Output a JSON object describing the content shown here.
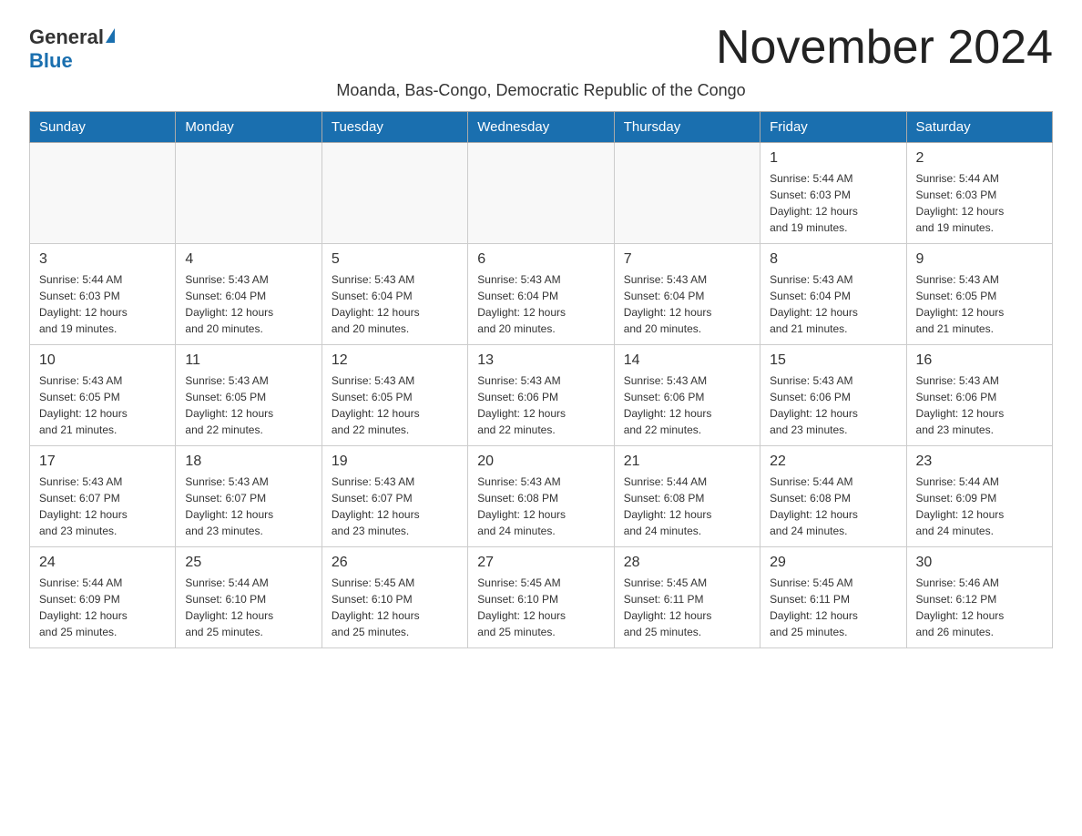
{
  "header": {
    "logo_general": "General",
    "logo_blue": "Blue",
    "month_title": "November 2024",
    "subtitle": "Moanda, Bas-Congo, Democratic Republic of the Congo"
  },
  "weekdays": [
    "Sunday",
    "Monday",
    "Tuesday",
    "Wednesday",
    "Thursday",
    "Friday",
    "Saturday"
  ],
  "weeks": [
    [
      {
        "day": "",
        "info": ""
      },
      {
        "day": "",
        "info": ""
      },
      {
        "day": "",
        "info": ""
      },
      {
        "day": "",
        "info": ""
      },
      {
        "day": "",
        "info": ""
      },
      {
        "day": "1",
        "info": "Sunrise: 5:44 AM\nSunset: 6:03 PM\nDaylight: 12 hours\nand 19 minutes."
      },
      {
        "day": "2",
        "info": "Sunrise: 5:44 AM\nSunset: 6:03 PM\nDaylight: 12 hours\nand 19 minutes."
      }
    ],
    [
      {
        "day": "3",
        "info": "Sunrise: 5:44 AM\nSunset: 6:03 PM\nDaylight: 12 hours\nand 19 minutes."
      },
      {
        "day": "4",
        "info": "Sunrise: 5:43 AM\nSunset: 6:04 PM\nDaylight: 12 hours\nand 20 minutes."
      },
      {
        "day": "5",
        "info": "Sunrise: 5:43 AM\nSunset: 6:04 PM\nDaylight: 12 hours\nand 20 minutes."
      },
      {
        "day": "6",
        "info": "Sunrise: 5:43 AM\nSunset: 6:04 PM\nDaylight: 12 hours\nand 20 minutes."
      },
      {
        "day": "7",
        "info": "Sunrise: 5:43 AM\nSunset: 6:04 PM\nDaylight: 12 hours\nand 20 minutes."
      },
      {
        "day": "8",
        "info": "Sunrise: 5:43 AM\nSunset: 6:04 PM\nDaylight: 12 hours\nand 21 minutes."
      },
      {
        "day": "9",
        "info": "Sunrise: 5:43 AM\nSunset: 6:05 PM\nDaylight: 12 hours\nand 21 minutes."
      }
    ],
    [
      {
        "day": "10",
        "info": "Sunrise: 5:43 AM\nSunset: 6:05 PM\nDaylight: 12 hours\nand 21 minutes."
      },
      {
        "day": "11",
        "info": "Sunrise: 5:43 AM\nSunset: 6:05 PM\nDaylight: 12 hours\nand 22 minutes."
      },
      {
        "day": "12",
        "info": "Sunrise: 5:43 AM\nSunset: 6:05 PM\nDaylight: 12 hours\nand 22 minutes."
      },
      {
        "day": "13",
        "info": "Sunrise: 5:43 AM\nSunset: 6:06 PM\nDaylight: 12 hours\nand 22 minutes."
      },
      {
        "day": "14",
        "info": "Sunrise: 5:43 AM\nSunset: 6:06 PM\nDaylight: 12 hours\nand 22 minutes."
      },
      {
        "day": "15",
        "info": "Sunrise: 5:43 AM\nSunset: 6:06 PM\nDaylight: 12 hours\nand 23 minutes."
      },
      {
        "day": "16",
        "info": "Sunrise: 5:43 AM\nSunset: 6:06 PM\nDaylight: 12 hours\nand 23 minutes."
      }
    ],
    [
      {
        "day": "17",
        "info": "Sunrise: 5:43 AM\nSunset: 6:07 PM\nDaylight: 12 hours\nand 23 minutes."
      },
      {
        "day": "18",
        "info": "Sunrise: 5:43 AM\nSunset: 6:07 PM\nDaylight: 12 hours\nand 23 minutes."
      },
      {
        "day": "19",
        "info": "Sunrise: 5:43 AM\nSunset: 6:07 PM\nDaylight: 12 hours\nand 23 minutes."
      },
      {
        "day": "20",
        "info": "Sunrise: 5:43 AM\nSunset: 6:08 PM\nDaylight: 12 hours\nand 24 minutes."
      },
      {
        "day": "21",
        "info": "Sunrise: 5:44 AM\nSunset: 6:08 PM\nDaylight: 12 hours\nand 24 minutes."
      },
      {
        "day": "22",
        "info": "Sunrise: 5:44 AM\nSunset: 6:08 PM\nDaylight: 12 hours\nand 24 minutes."
      },
      {
        "day": "23",
        "info": "Sunrise: 5:44 AM\nSunset: 6:09 PM\nDaylight: 12 hours\nand 24 minutes."
      }
    ],
    [
      {
        "day": "24",
        "info": "Sunrise: 5:44 AM\nSunset: 6:09 PM\nDaylight: 12 hours\nand 25 minutes."
      },
      {
        "day": "25",
        "info": "Sunrise: 5:44 AM\nSunset: 6:10 PM\nDaylight: 12 hours\nand 25 minutes."
      },
      {
        "day": "26",
        "info": "Sunrise: 5:45 AM\nSunset: 6:10 PM\nDaylight: 12 hours\nand 25 minutes."
      },
      {
        "day": "27",
        "info": "Sunrise: 5:45 AM\nSunset: 6:10 PM\nDaylight: 12 hours\nand 25 minutes."
      },
      {
        "day": "28",
        "info": "Sunrise: 5:45 AM\nSunset: 6:11 PM\nDaylight: 12 hours\nand 25 minutes."
      },
      {
        "day": "29",
        "info": "Sunrise: 5:45 AM\nSunset: 6:11 PM\nDaylight: 12 hours\nand 25 minutes."
      },
      {
        "day": "30",
        "info": "Sunrise: 5:46 AM\nSunset: 6:12 PM\nDaylight: 12 hours\nand 26 minutes."
      }
    ]
  ]
}
